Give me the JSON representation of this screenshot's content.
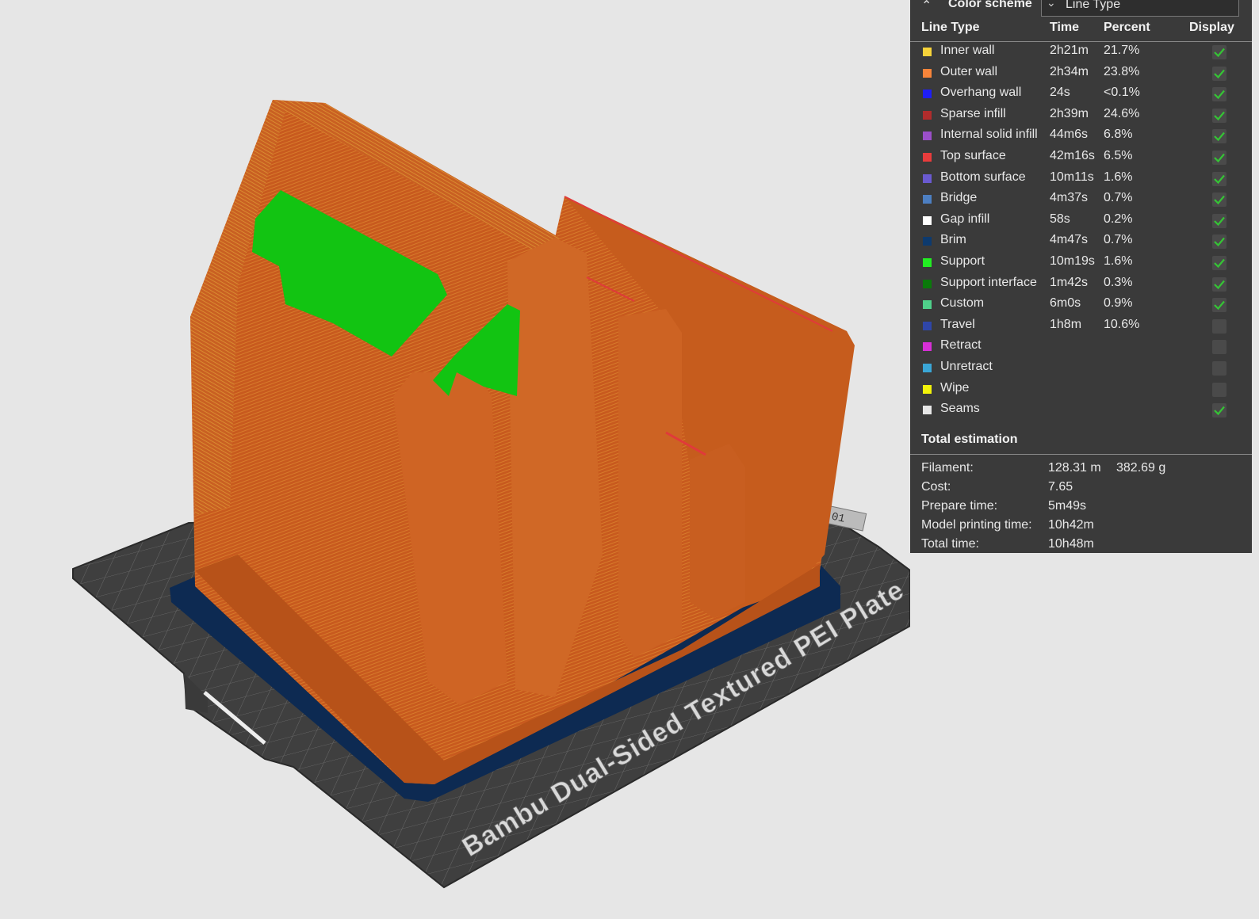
{
  "color_scheme": {
    "label": "Color scheme",
    "selected": "Line Type",
    "collapse_icon": "double-chevron-up-icon",
    "dropdown_icon": "chevron-down-icon"
  },
  "table": {
    "headers": {
      "line_type": "Line Type",
      "time": "Time",
      "percent": "Percent",
      "display": "Display"
    },
    "rows": [
      {
        "name": "Inner wall",
        "time": "2h21m",
        "percent": "21.7%",
        "color": "#f7d33a",
        "display": true
      },
      {
        "name": "Outer wall",
        "time": "2h34m",
        "percent": "23.8%",
        "color": "#f7843a",
        "display": true
      },
      {
        "name": "Overhang wall",
        "time": "24s",
        "percent": "<0.1%",
        "color": "#1e1ef7",
        "display": true
      },
      {
        "name": "Sparse infill",
        "time": "2h39m",
        "percent": "24.6%",
        "color": "#b02c2c",
        "display": true
      },
      {
        "name": "Internal solid infill",
        "time": "44m6s",
        "percent": "6.8%",
        "color": "#9b4fc9",
        "display": true
      },
      {
        "name": "Top surface",
        "time": "42m16s",
        "percent": "6.5%",
        "color": "#e83c3c",
        "display": true
      },
      {
        "name": "Bottom surface",
        "time": "10m11s",
        "percent": "1.6%",
        "color": "#6a5ad0",
        "display": true
      },
      {
        "name": "Bridge",
        "time": "4m37s",
        "percent": "0.7%",
        "color": "#4d7fc2",
        "display": true
      },
      {
        "name": "Gap infill",
        "time": "58s",
        "percent": "0.2%",
        "color": "#ffffff",
        "display": true
      },
      {
        "name": "Brim",
        "time": "4m47s",
        "percent": "0.7%",
        "color": "#0d3a6e",
        "display": true
      },
      {
        "name": "Support",
        "time": "10m19s",
        "percent": "1.6%",
        "color": "#22ee22",
        "display": true
      },
      {
        "name": "Support interface",
        "time": "1m42s",
        "percent": "0.3%",
        "color": "#0a7a0a",
        "display": true
      },
      {
        "name": "Custom",
        "time": "6m0s",
        "percent": "0.9%",
        "color": "#4fd08a",
        "display": true
      },
      {
        "name": "Travel",
        "time": "1h8m",
        "percent": "10.6%",
        "color": "#2f46a8",
        "display": false
      },
      {
        "name": "Retract",
        "time": "",
        "percent": "",
        "color": "#d62fd6",
        "display": false
      },
      {
        "name": "Unretract",
        "time": "",
        "percent": "",
        "color": "#3aa6d6",
        "display": false
      },
      {
        "name": "Wipe",
        "time": "",
        "percent": "",
        "color": "#f2f20a",
        "display": false
      },
      {
        "name": "Seams",
        "time": "",
        "percent": "",
        "color": "#e6e6e6",
        "display": true
      }
    ]
  },
  "total": {
    "title": "Total estimation",
    "filament_label": "Filament:",
    "filament_length": "128.31 m",
    "filament_weight": "382.69 g",
    "cost_label": "Cost:",
    "cost": "7.65",
    "prepare_label": "Prepare time:",
    "prepare": "5m49s",
    "model_label": "Model printing time:",
    "model": "10h42m",
    "total_label": "Total time:",
    "total_time": "10h48m"
  },
  "plate": {
    "name": "Bambu Dual-Sided Textured PEI Plate",
    "number": "01"
  },
  "colors": {
    "model_orange": "#c85a1e",
    "support_green": "#12c412",
    "brim_blue": "#0d2a52",
    "plate_dark": "#3d3d3d",
    "panel_bg": "#3a3a3a",
    "check_green": "#35c435"
  }
}
